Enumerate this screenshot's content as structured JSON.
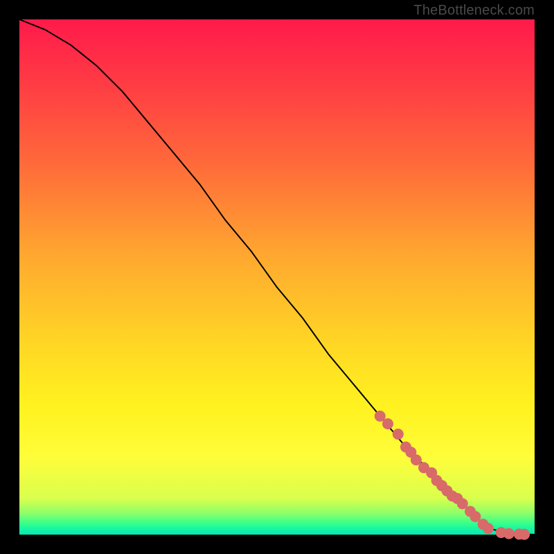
{
  "attribution": "TheBottleneck.com",
  "colors": {
    "frame": "#000000",
    "gradient_top": "#ff1a4b",
    "gradient_mid": "#fff21f",
    "gradient_bottom": "#00e8b8",
    "curve": "#000000",
    "marker": "#d86a6a"
  },
  "chart_data": {
    "type": "line",
    "title": "",
    "xlabel": "",
    "ylabel": "",
    "xlim": [
      0,
      100
    ],
    "ylim": [
      0,
      100
    ],
    "grid": false,
    "series": [
      {
        "name": "curve",
        "style": "line",
        "x": [
          0,
          5,
          10,
          15,
          20,
          25,
          30,
          35,
          40,
          45,
          50,
          55,
          60,
          65,
          70,
          75,
          80,
          85,
          88,
          90,
          92,
          94,
          96,
          98,
          100
        ],
        "y": [
          100,
          98,
          95,
          91,
          86,
          80,
          74,
          68,
          61,
          55,
          48,
          42,
          35,
          29,
          23,
          17,
          12,
          7,
          4,
          2,
          1,
          0.5,
          0.2,
          0.1,
          0
        ]
      },
      {
        "name": "markers",
        "style": "points",
        "x": [
          70,
          71.5,
          73.5,
          75,
          76,
          77,
          78.5,
          80,
          81,
          82,
          83,
          84,
          85,
          86,
          87.5,
          88.5,
          90,
          91,
          93.5,
          95,
          97,
          98
        ],
        "y": [
          23,
          21.5,
          19.5,
          17,
          16,
          14.5,
          13,
          12,
          10.5,
          9.5,
          8.5,
          7.5,
          7,
          6,
          4.5,
          3.5,
          2,
          1.2,
          0.4,
          0.2,
          0.1,
          0.05
        ]
      }
    ]
  }
}
